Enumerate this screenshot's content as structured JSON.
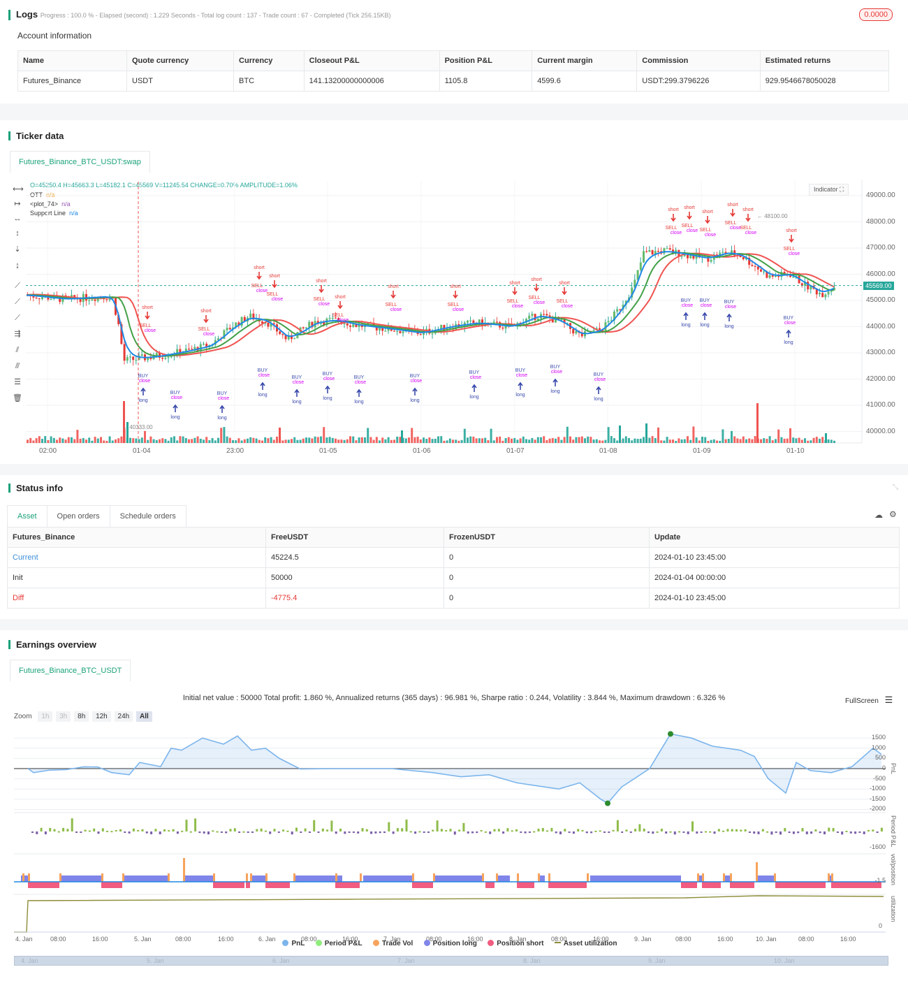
{
  "logs": {
    "title": "Logs",
    "progress_text": "Progress : 100.0 % - Elapsed (second) : 1.229  Seconds - Total log count : 137 - Trade count : 67 - Completed (Tick 256.15KB)",
    "badge": "0.0000",
    "account_title": "Account information",
    "headers": [
      "Name",
      "Quote currency",
      "Currency",
      "Closeout P&L",
      "Position P&L",
      "Current margin",
      "Commission",
      "Estimated returns"
    ],
    "row": [
      "Futures_Binance",
      "USDT",
      "BTC",
      "141.13200000000006",
      "1105.8",
      "4599.6",
      "USDT:299.3796226",
      "929.9546678050028"
    ]
  },
  "ticker": {
    "title": "Ticker data",
    "tab": "Futures_Binance_BTC_USDT:swap",
    "ohlc": "O=45250.4 H=45663.3 L=45182.1 C=45569 V=11245.54 CHANGE=0.70% AMPLITUDE=1.06%",
    "legend": [
      {
        "name": "OTT",
        "value": "n/a",
        "color": "#f0a030"
      },
      {
        "name": "<plot_74>",
        "value": "n/a",
        "color": "#9b59b6"
      },
      {
        "name": "Support Line",
        "value": "n/a",
        "color": "#1e88e5"
      }
    ],
    "indicator_btn": "Indicator",
    "price_ticks": [
      "49000.00",
      "48000.00",
      "47000.00",
      "46000.00",
      "45000.00",
      "44000.00",
      "43000.00",
      "42000.00",
      "41000.00",
      "40000.00"
    ],
    "current_price": "45569.00",
    "high_mark": "48100.00",
    "low_mark": "40333.00",
    "time_ticks": [
      "02:00",
      "01-04",
      "23:00",
      "01-05",
      "01-06",
      "01-07",
      "01-08",
      "01-09",
      "01-10"
    ],
    "signal_labels": {
      "short": "short",
      "sell": "SELL",
      "close": "close",
      "long": "long",
      "buy": "BUY",
      "one": "1"
    }
  },
  "status": {
    "title": "Status info",
    "tabs": [
      "Asset",
      "Open orders",
      "Schedule orders"
    ],
    "headers": [
      "Futures_Binance",
      "FreeUSDT",
      "FrozenUSDT",
      "Update"
    ],
    "rows": [
      [
        "Current",
        "45224.5",
        "0",
        "2024-01-10 23:45:00"
      ],
      [
        "Init",
        "50000",
        "0",
        "2024-01-04 00:00:00"
      ],
      [
        "Diff",
        "-4775.4",
        "0",
        "2024-01-10 23:45:00"
      ]
    ]
  },
  "earnings": {
    "title": "Earnings overview",
    "tab": "Futures_Binance_BTC_USDT",
    "summary": "Initial net value : 50000 Total profit: 1.860 %, Annualized returns (365 days) : 96.981 %, Sharpe ratio : 0.244, Volatility : 3.844 %, Maximum drawdown : 6.326 %",
    "fullscreen": "FullScreen",
    "zoom_label": "Zoom",
    "zoom_buttons": [
      "1h",
      "3h",
      "8h",
      "12h",
      "24h",
      "All"
    ],
    "pnl_ticks": [
      "1500",
      "1000",
      "500",
      "0",
      "-500",
      "-1000",
      "-1500",
      "-2000"
    ],
    "axis_titles": [
      "PnL",
      "Period P&L",
      "vol/position",
      "utilization"
    ],
    "period_tick": "-1600",
    "vol_tick": "-1.5",
    "util_tick": "0",
    "time_ticks": [
      "4. Jan",
      "08:00",
      "16:00",
      "5. Jan",
      "08:00",
      "16:00",
      "6. Jan",
      "08:00",
      "16:00",
      "7. Jan",
      "08:00",
      "16:00",
      "8. Jan",
      "08:00",
      "16:00",
      "9. Jan",
      "08:00",
      "16:00",
      "10. Jan",
      "08:00",
      "16:00"
    ],
    "nav_ticks": [
      "4. Jan",
      "5. Jan",
      "6. Jan",
      "7. Jan",
      "8. Jan",
      "9. Jan",
      "10. Jan"
    ],
    "legend": [
      {
        "name": "PnL",
        "color": "#7cb5ec"
      },
      {
        "name": "Period P&L",
        "color": "#90ed7d"
      },
      {
        "name": "Trade Vol",
        "color": "#f7a35c"
      },
      {
        "name": "Position long",
        "color": "#8085e9"
      },
      {
        "name": "Position short",
        "color": "#f15c80"
      },
      {
        "name": "Asset utilization",
        "color": "#8d8d3a"
      }
    ]
  }
}
